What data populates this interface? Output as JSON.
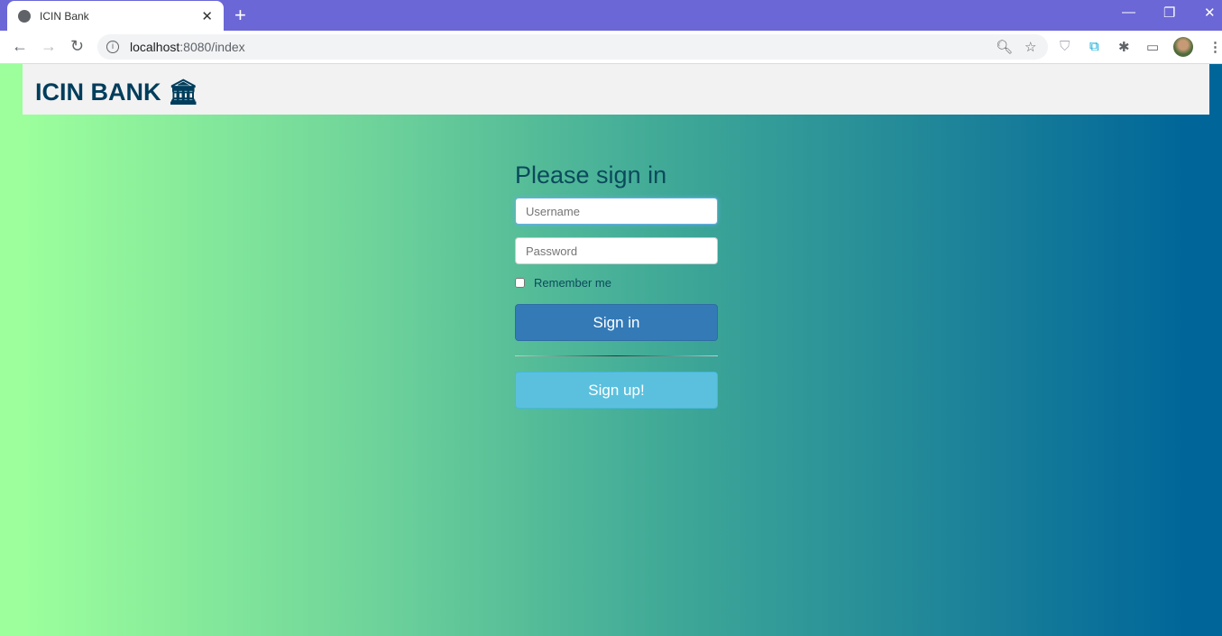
{
  "browser": {
    "tab_title": "ICIN Bank",
    "url_host": "localhost",
    "url_path": ":8080/index"
  },
  "header": {
    "brand": "ICIN BANK",
    "brand_icon": "bank-icon"
  },
  "form": {
    "title": "Please sign in",
    "username_placeholder": "Username",
    "password_placeholder": "Password",
    "remember_label": "Remember me",
    "signin_label": "Sign in",
    "signup_label": "Sign up!"
  },
  "colors": {
    "tabbar": "#6b67d6",
    "brand": "#003d5c",
    "signin": "#337ab7",
    "signup": "#5bc0de",
    "gradient_start": "#9cff9c",
    "gradient_end": "#006699"
  }
}
